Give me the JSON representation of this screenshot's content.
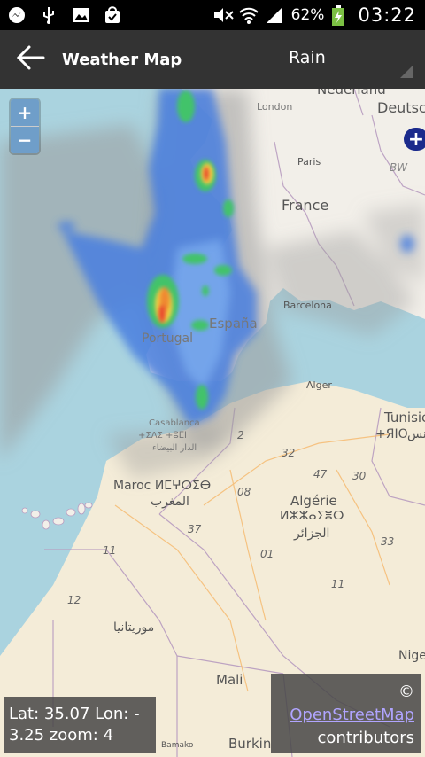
{
  "status_bar": {
    "battery": "62%",
    "time": "03:22",
    "icons": [
      "messenger-icon",
      "usb-icon",
      "image-icon",
      "shopping-bag-icon",
      "mute-icon",
      "wifi-icon",
      "signal-icon",
      "battery-charging-icon"
    ]
  },
  "action_bar": {
    "title": "Weather Map",
    "layer_selected": "Rain",
    "back_icon": "back-arrow-icon"
  },
  "map": {
    "zoom_in": "+",
    "zoom_out": "−",
    "labels": {
      "london": "London",
      "nederland": "Nederland",
      "deutsch": "Deutsch",
      "paris": "Paris",
      "bw": "BW",
      "france": "France",
      "espana": "España",
      "barcelona": "Barcelona",
      "portugal": "Portugal",
      "alger": "Alger",
      "tunisie": "Tunisie",
      "tunisie_tif": "+ЯІО",
      "tunisie_ar": "تونس",
      "casablanca": "Casablanca",
      "casablanca_tif": "+ΣΛΣ +ⵓⵎⵏ",
      "casablanca_ar": "الدار البيضاء",
      "maroc": "Maroc ⵍⵎⵖⵔⵉⴱ",
      "maroc_ar": "المغرب",
      "algerie": "Algérie",
      "algerie_tif": "ⵍⵣⵣⴰⵢⴻⵔ",
      "algerie_ar": "الجزائر",
      "mauritanie_ar": "موريتانيا",
      "mali": "Mali",
      "bamako": "Bamako",
      "burkina": "Burkin",
      "niger": "Nige"
    },
    "road_numbers": [
      "2",
      "32",
      "47",
      "30",
      "08",
      "37",
      "01",
      "33",
      "11",
      "11",
      "12"
    ],
    "plus_badge": "+"
  },
  "coord_readout": {
    "line1": "Lat: 35.07 Lon: -",
    "line2": "3.25 zoom: 4"
  },
  "attribution": {
    "copyright": "©",
    "link": "OpenStreetMap",
    "suffix": "contributors"
  },
  "colors": {
    "status_bg": "#000000",
    "action_bar_bg": "#333333",
    "sea": "#aad3df",
    "land": "#f2efe9",
    "desert": "#f4ecd8",
    "rain_light": "#4a7fe0",
    "rain_mid": "#43c36b",
    "rain_heavy": "#e84a2e",
    "link": "#b0a4ff"
  }
}
